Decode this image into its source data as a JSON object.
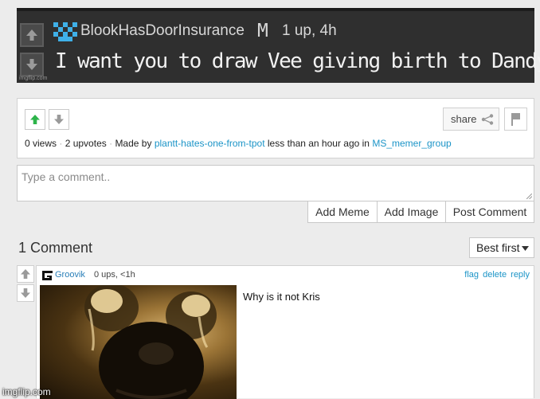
{
  "meme": {
    "username": "BlookHasDoorInsurance",
    "mod_badge": "M",
    "ups": "1 up, 4h",
    "text": "I want you to draw Vee giving birth to Dandy",
    "watermark": "imgflip.com"
  },
  "post": {
    "share_label": "share",
    "views": "0 views",
    "upvotes": "2 upvotes",
    "made_by_prefix": "Made by",
    "author": "plantt-hates-one-from-tpot",
    "time_text": "less than an hour ago in",
    "stream": "MS_memer_group",
    "separator": "·"
  },
  "composer": {
    "placeholder": "Type a comment..",
    "add_meme": "Add Meme",
    "add_image": "Add Image",
    "post_comment": "Post Comment"
  },
  "comments": {
    "count_label": "1 Comment",
    "sort_label": "Best first",
    "items": [
      {
        "username": "Groovik",
        "meta": "0 ups, <1h",
        "flag": "flag",
        "delete": "delete",
        "reply": "reply",
        "text": "Why is it not Kris"
      }
    ]
  },
  "page": {
    "watermark": "imgflip.com"
  },
  "colors": {
    "link": "#1b94c7",
    "upvote_active": "#2db44a",
    "meme_bg": "#2f2f2f"
  }
}
